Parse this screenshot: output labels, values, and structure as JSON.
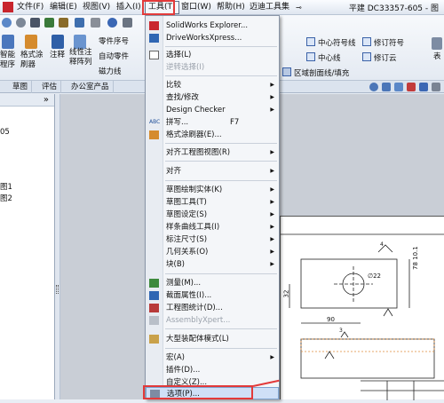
{
  "menubar": {
    "file": "文件(F)",
    "edit": "编辑(E)",
    "view": "视图(V)",
    "insert": "插入(I)",
    "tools": "工具(T)",
    "window": "窗口(W)",
    "help": "帮助(H)",
    "maidi": "迈迪工具集",
    "window_title": "平建 DC33357-605 - 图"
  },
  "toolbar": {
    "btn1": "智能\n程序",
    "btn2": "格式涂\n刷器",
    "annot": "注释",
    "balloon": "线性注\n释阵列",
    "part_no": "零件序号",
    "auto_part": "自动零件",
    "magnet": "磁力线",
    "center_sym": "中心符号线",
    "center_line": "中心线",
    "revision_sym": "修订符号",
    "revision_cloud": "修订云",
    "area_hatch": "区域剖面线/填充",
    "table": "表"
  },
  "tabs": [
    "草图",
    "评估",
    "办公室产品"
  ],
  "left_panel": {
    "collapse": "»",
    "items": [
      "05",
      "图1",
      "图2"
    ]
  },
  "tools_menu": {
    "items": {
      "solidworks_explorer": "SolidWorks Explorer...",
      "driveworks": "DriveWorksXpress...",
      "select": "选择(L)",
      "reverse_select": "逆转选择(I)",
      "compare": "比较",
      "find_modify": "查找/修改",
      "design_checker": "Design Checker",
      "spelling": "拼写...",
      "spelling_shortcut": "F7",
      "format_painter": "格式涂刷器(E)...",
      "align_views": "对齐工程图视图(R)",
      "align": "对齐",
      "sketch_entities": "草图绘制实体(K)",
      "sketch_tools": "草图工具(T)",
      "sketch_settings": "草图设定(S)",
      "spline_tools": "样条曲线工具(I)",
      "dimensions": "标注尺寸(S)",
      "relations": "几何关系(O)",
      "blocks": "块(B)",
      "measure": "测量(M)...",
      "section_props": "截面属性(I)...",
      "drawing_stats": "工程图统计(D)...",
      "assembly_xpert": "AssemblyXpert...",
      "large_assembly": "大型装配体模式(L)",
      "macro": "宏(A)",
      "addins": "插件(D)...",
      "customize": "自定义(Z)...",
      "options": "选项(P)..."
    }
  },
  "drawing": {
    "dim_32": "32",
    "dim_90": "90",
    "dim_phi22": "∅22",
    "dim_7810": "78 10.1",
    "dim_4": "4",
    "dim_3": "3"
  },
  "colors": {
    "highlight_red": "#e23a3a",
    "menu_bg": "#f4f6f9",
    "selected_bg": "#cfe0f7"
  }
}
